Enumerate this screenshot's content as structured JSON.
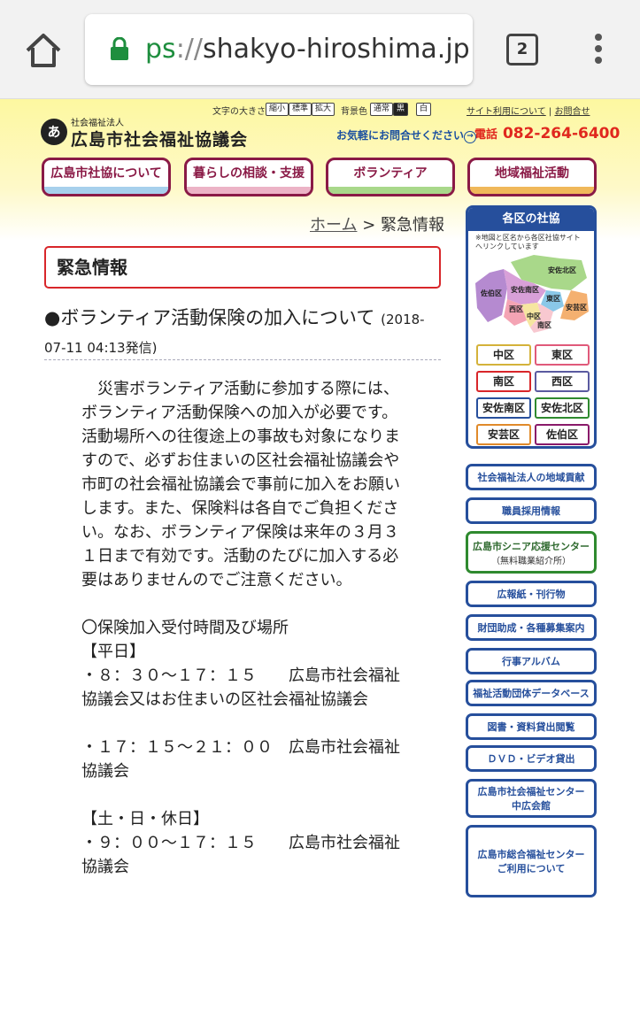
{
  "browser": {
    "url_scheme": "ps",
    "url_slashes": "://",
    "url_host": "shakyo-hiroshima.jp",
    "tab_count": "2"
  },
  "header": {
    "logo_small": "社会福祉法人",
    "logo_name": "広島市社会福祉協議会",
    "logo_mark": "あ",
    "font_size_label": "文字の大きさ",
    "font_sizes": [
      "縮小",
      "標準",
      "拡大"
    ],
    "bg_label": "背景色",
    "bg_options": [
      "通常",
      "黒",
      "白"
    ],
    "site_link": "サイト利用について",
    "separator": "|",
    "contact_link": "お問合せ",
    "contact_text": "お気軽にお問合せください",
    "contact_arrow": "→",
    "phone_label": "電話",
    "phone_number": "082-264-6400"
  },
  "nav": [
    {
      "label": "広島市社協について",
      "color": "#a7d0ec"
    },
    {
      "label": "暮らしの相談・支援",
      "color": "#ecb3c6"
    },
    {
      "label": "ボランティア",
      "color": "#a9d88a"
    },
    {
      "label": "地域福祉活動",
      "color": "#f0b85a"
    }
  ],
  "breadcrumb": {
    "home": "ホーム",
    "sep": ">",
    "current": "緊急情報"
  },
  "page_title": "緊急情報",
  "article": {
    "title": "●ボランティア活動保険の加入について",
    "date": "(2018-07-11 04:13発信)",
    "body": "　災害ボランティア活動に参加する際には、ボランティア活動保険への加入が必要です。活動場所への往復途上の事故も対象になりますので、必ずお住まいの区社会福祉協議会や市町の社会福祉協議会で事前に加入をお願いします。また、保険料は各自でご負担ください。なお、ボランティア保険は来年の３月３１日まで有効です。活動のたびに加入する必要はありませんのでご注意ください。\n\n〇保険加入受付時間及び場所\n【平日】\n・８：３０～１７：１５　　広島市社会福祉協議会又はお住まいの区社会福祉協議会\n\n・１７：１５～２１：００　広島市社会福祉協議会\n\n【土・日・休日】\n・９：００～１７：１５　　広島市社会福祉協議会"
  },
  "sidebar": {
    "ward_title": "各区の社協",
    "ward_note": "※地図と区名から各区社協サイトへリンクしています",
    "map_labels": [
      "安佐北区",
      "佐伯区",
      "安佐南区",
      "東区",
      "西区",
      "中区",
      "南区",
      "安芸区"
    ],
    "wards": [
      {
        "label": "中区",
        "color": "#d4b23a"
      },
      {
        "label": "東区",
        "color": "#e05a7a"
      },
      {
        "label": "南区",
        "color": "#d8262a"
      },
      {
        "label": "西区",
        "color": "#5a5aa0"
      },
      {
        "label": "安佐南区",
        "color": "#264f9c"
      },
      {
        "label": "安佐北区",
        "color": "#2f8a2f"
      },
      {
        "label": "安芸区",
        "color": "#e08a2a"
      },
      {
        "label": "佐伯区",
        "color": "#8a1a6a"
      }
    ],
    "links": [
      {
        "label": "社会福祉法人の地域貢献"
      },
      {
        "label": "職員採用情報"
      },
      {
        "label": "広島市シニア応援センター",
        "sub": "（無料職業紹介所）"
      },
      {
        "label": "広報紙・刊行物"
      },
      {
        "label": "財団助成・各種募集案内"
      },
      {
        "label": "行事アルバム"
      },
      {
        "label": "福祉活動団体データベース"
      },
      {
        "label": "図書・資料貸出閲覧"
      },
      {
        "label": "ＤＶＤ・ビデオ貸出"
      },
      {
        "label": "広島市社会福祉センター",
        "sub": "中広会館"
      },
      {
        "label": "広島市総合福祉センター",
        "sub": "ご利用について"
      }
    ]
  }
}
